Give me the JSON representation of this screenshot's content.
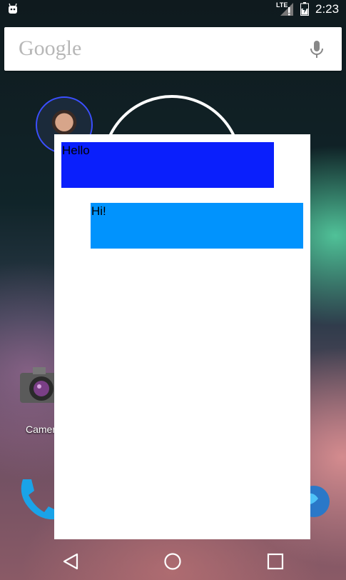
{
  "status_bar": {
    "network_label": "LTE",
    "time": "2:23",
    "icons": [
      "android-debug-icon",
      "signal-icon",
      "battery-icon"
    ]
  },
  "search_bar": {
    "logo_text": "Google",
    "mic_icon": "mic-icon"
  },
  "home_screen": {
    "apps": [
      {
        "label": "Camera",
        "visible_label": "Camer",
        "icon": "camera-icon"
      },
      {
        "label": "",
        "icon": "phone-icon"
      },
      {
        "label": "",
        "icon": "browser-icon"
      }
    ],
    "widgets": [
      "contact-avatar",
      "clock-widget"
    ]
  },
  "chat": {
    "messages": [
      {
        "text": "Hello",
        "color": "#0a1ffc",
        "side": "incoming"
      },
      {
        "text": "Hi!",
        "color": "#0193fd",
        "side": "outgoing"
      }
    ]
  },
  "nav_bar": {
    "buttons": [
      "back-icon",
      "home-icon",
      "recents-icon"
    ]
  }
}
